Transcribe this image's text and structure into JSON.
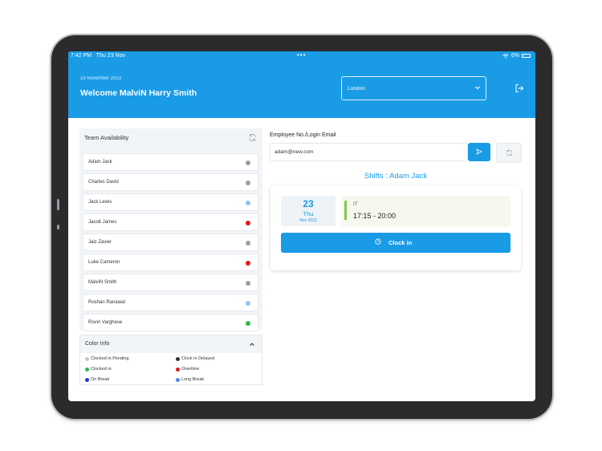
{
  "status_bar": {
    "time": "7:42 PM",
    "date": "Thu 23 Nov",
    "dots": "•••",
    "battery": "6%"
  },
  "header": {
    "date": "23 November 2023",
    "welcome": "Welcome MalviN Harry Smith",
    "location": "London",
    "logout_icon": "logout-icon"
  },
  "team": {
    "title": "Team Availability",
    "members": [
      {
        "name": "Adam Jack",
        "status_color": "#9e9e9e"
      },
      {
        "name": "Charles David",
        "status_color": "#9e9e9e"
      },
      {
        "name": "Jack Lewis",
        "status_color": "#8ec5f5"
      },
      {
        "name": "Jacob James",
        "status_color": "#e01b1b"
      },
      {
        "name": "Jaiz Zavier",
        "status_color": "#9e9e9e"
      },
      {
        "name": "Luke Cameron",
        "status_color": "#e01b1b"
      },
      {
        "name": "MalviN Smith",
        "status_color": "#9e9e9e"
      },
      {
        "name": "Roshan Ranawat",
        "status_color": "#8ec5f5"
      },
      {
        "name": "Rovin Varghese",
        "status_color": "#2db84d"
      }
    ]
  },
  "color_info": {
    "title": "Color Info",
    "items": [
      {
        "label": "Clocked in Pending",
        "color": "#c8c8c8"
      },
      {
        "label": "Clock in Delayed",
        "color": "#333333"
      },
      {
        "label": "Clocked in",
        "color": "#2db84d"
      },
      {
        "label": "Overtime",
        "color": "#e01b1b"
      },
      {
        "label": "On Break",
        "color": "#1e3fd0"
      },
      {
        "label": "Long Break",
        "color": "#4a86e8"
      }
    ]
  },
  "employee": {
    "label": "Employee No./Login Email",
    "value": "adam@new.com"
  },
  "shifts": {
    "title": "Shifts : Adam Jack",
    "day": "23",
    "weekday": "Thu",
    "month_year": "Nov 2023",
    "department": "IT",
    "time": "17:15 - 20:00",
    "clock_in_label": "Clock in"
  },
  "colors": {
    "primary": "#1a9be6",
    "shift_accent": "#8bc34a"
  }
}
